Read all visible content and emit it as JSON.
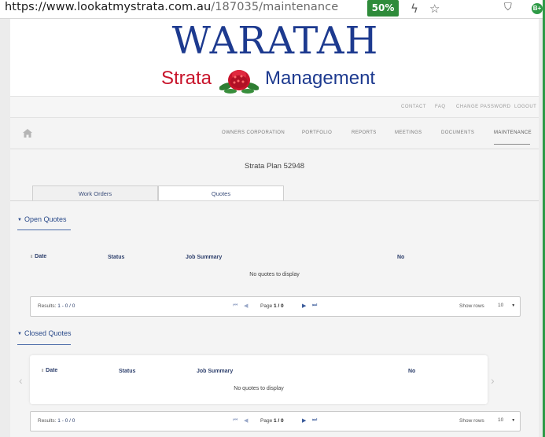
{
  "browser": {
    "url_main": "https://www.lookatmystrata.com.au",
    "url_path": "/187035/maintenance",
    "zoom": "50%",
    "profile_initials": "B+"
  },
  "logo": {
    "title": "WARATAH",
    "left_word": "Strata",
    "right_word": "Management"
  },
  "top_links": [
    "CONTACT",
    "FAQ",
    "CHANGE PASSWORD",
    "LOGOUT"
  ],
  "nav": {
    "items": [
      "OWNERS CORPORATION",
      "PORTFOLIO",
      "REPORTS",
      "MEETINGS",
      "DOCUMENTS",
      "MAINTENANCE"
    ],
    "active": "MAINTENANCE"
  },
  "plan_title": "Strata Plan 52948",
  "tabs": [
    {
      "label": "Work Orders",
      "active": false
    },
    {
      "label": "Quotes",
      "active": true
    }
  ],
  "open_quotes": {
    "heading": "Open Quotes",
    "columns": [
      "Date",
      "Status",
      "Job Summary",
      "No"
    ],
    "empty_text": "No quotes to display",
    "pager": {
      "results_label": "Results:",
      "results_value": "1 - 0 / 0",
      "page_label": "Page",
      "page_value": "1 / 0",
      "show_rows_label": "Show rows",
      "rows_value": "10"
    }
  },
  "closed_quotes": {
    "heading": "Closed Quotes",
    "columns": [
      "Date",
      "Status",
      "Job Summary",
      "No"
    ],
    "empty_text": "No quotes to display",
    "pager": {
      "results_label": "Results:",
      "results_value": "1 - 0 / 0",
      "page_label": "Page",
      "page_value": "1 / 0",
      "show_rows_label": "Show rows",
      "rows_value": "10"
    }
  },
  "colors": {
    "brand_blue": "#1d3a8f",
    "brand_red": "#c8132a",
    "zoom_green": "#2e8b3a",
    "link_blue": "#2a4a8a"
  },
  "icons": [
    "home-icon",
    "caret-down-icon",
    "sort-icon",
    "first-page-icon",
    "prev-page-icon",
    "next-page-icon",
    "last-page-icon",
    "dropdown-icon"
  ]
}
